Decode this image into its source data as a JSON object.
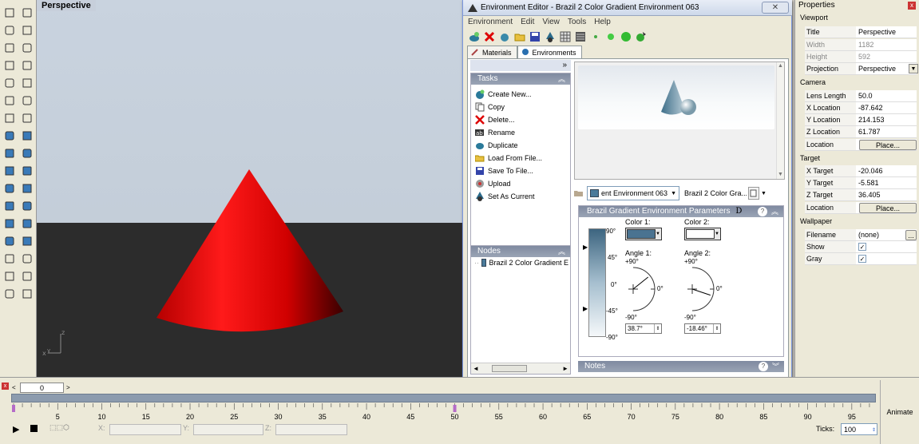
{
  "viewport": {
    "title": "Perspective",
    "axis_z": "z",
    "axis_x": "x",
    "axis_y": "y"
  },
  "env_editor": {
    "title": "Environment Editor - Brazil 2 Color Gradient Environment 063",
    "close_label": "✕",
    "menu": [
      "Environment",
      "Edit",
      "View",
      "Tools",
      "Help"
    ],
    "tabs": [
      "Materials",
      "Environments"
    ],
    "tasks_header": "Tasks",
    "tasks": [
      {
        "label": "Create New...",
        "icon": "create-new-icon"
      },
      {
        "label": "Copy",
        "icon": "copy-icon"
      },
      {
        "label": "Delete...",
        "icon": "delete-icon"
      },
      {
        "label": "Rename",
        "icon": "rename-icon"
      },
      {
        "label": "Duplicate",
        "icon": "duplicate-icon"
      },
      {
        "label": "Load From File...",
        "icon": "load-icon"
      },
      {
        "label": "Save To File...",
        "icon": "save-icon"
      },
      {
        "label": "Upload",
        "icon": "upload-icon"
      },
      {
        "label": "Set As Current",
        "icon": "set-current-icon"
      }
    ],
    "nodes_header": "Nodes",
    "node_item": "Brazil 2 Color Gradient E",
    "combo_env": "ent Environment 063",
    "combo_type": "Brazil 2 Color Gra...",
    "params_header": "Brazil Gradient Environment Parameters",
    "params_badge": "D",
    "deg_labels": [
      "90°",
      "45°",
      "0°",
      "-45°",
      "-90°"
    ],
    "color1_label": "Color 1:",
    "color2_label": "Color 2:",
    "color1": "#4a7391",
    "color2": "#ffffff",
    "angle1_label": "Angle 1:",
    "angle2_label": "Angle 2:",
    "dial_top": "+90°",
    "dial_right": "0°",
    "dial_bottom": "-90°",
    "angle1_value": "38.7°",
    "angle2_value": "-18.46°",
    "angle1": 38.7,
    "angle2": -18.46,
    "notes_header": "Notes"
  },
  "properties": {
    "title": "Properties",
    "close_label": "x",
    "viewport_section": "Viewport",
    "title_key": "Title",
    "title_val": "Perspective",
    "width_key": "Width",
    "width_val": "1182",
    "height_key": "Height",
    "height_val": "592",
    "projection_key": "Projection",
    "projection_val": "Perspective",
    "camera_section": "Camera",
    "lens_key": "Lens Length",
    "lens_val": "50.0",
    "xloc_key": "X Location",
    "xloc_val": "-87.642",
    "yloc_key": "Y Location",
    "yloc_val": "214.153",
    "zloc_key": "Z Location",
    "zloc_val": "61.787",
    "loc_key": "Location",
    "place_label": "Place...",
    "target_section": "Target",
    "xt_key": "X Target",
    "xt_val": "-20.046",
    "yt_key": "Y Target",
    "yt_val": "-5.581",
    "zt_key": "Z Target",
    "zt_val": "36.405",
    "tloc_key": "Location",
    "wallpaper_section": "Wallpaper",
    "filename_key": "Filename",
    "filename_val": "(none)",
    "browse_label": "...",
    "show_key": "Show",
    "gray_key": "Gray",
    "check": "✓"
  },
  "timeline": {
    "frame_value": "0",
    "ticks": [
      "5",
      "10",
      "15",
      "20",
      "25",
      "30",
      "35",
      "40",
      "45",
      "50",
      "55",
      "60",
      "65",
      "70",
      "75",
      "80",
      "85",
      "90",
      "95"
    ],
    "animate_label": "Animate",
    "ticks_label": "Ticks:",
    "ticks_value": "100",
    "coord_x": "X:",
    "coord_y": "Y:",
    "coord_z": "Z:"
  }
}
